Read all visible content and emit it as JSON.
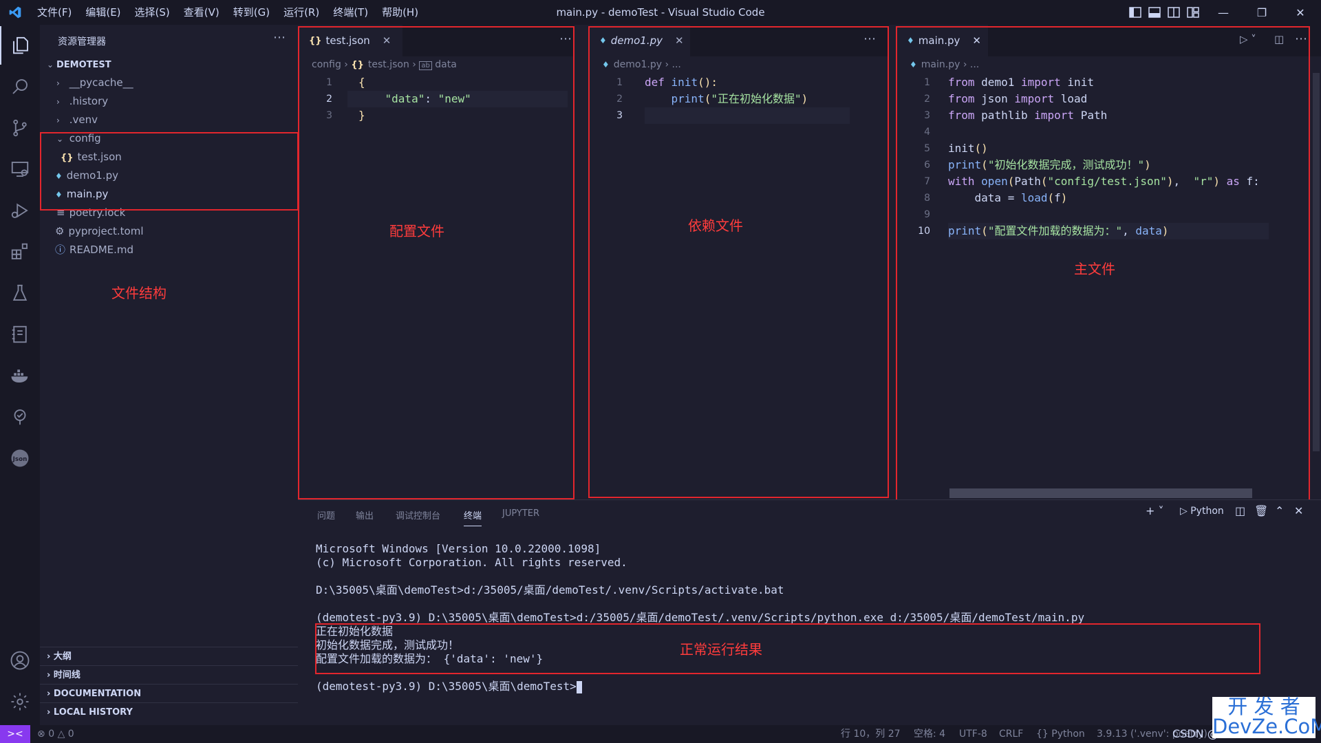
{
  "window": {
    "title": "main.py - demoTest - Visual Studio Code",
    "menu": [
      "文件(F)",
      "编辑(E)",
      "选择(S)",
      "查看(V)",
      "转到(G)",
      "运行(R)",
      "终端(T)",
      "帮助(H)"
    ]
  },
  "sidebar": {
    "title": "资源管理器",
    "root": "DEMOTEST",
    "items": [
      {
        "label": "__pycache__",
        "type": "folder"
      },
      {
        "label": ".history",
        "type": "folder"
      },
      {
        "label": ".venv",
        "type": "folder"
      },
      {
        "label": "config",
        "type": "folder-open"
      },
      {
        "label": "test.json",
        "type": "json"
      },
      {
        "label": "demo1.py",
        "type": "py"
      },
      {
        "label": "main.py",
        "type": "py"
      },
      {
        "label": "poetry.lock",
        "type": "lock"
      },
      {
        "label": "pyproject.toml",
        "type": "toml"
      },
      {
        "label": "README.md",
        "type": "md"
      }
    ],
    "sections": [
      "大纲",
      "时间线",
      "DOCUMENTATION",
      "LOCAL HISTORY"
    ]
  },
  "editors": {
    "json": {
      "tab": "test.json",
      "breadcrumb": [
        "config",
        "test.json",
        "data"
      ],
      "lines": [
        {
          "n": "1",
          "t": "{"
        },
        {
          "n": "2",
          "k": "\"data\"",
          "v": "\"new\""
        },
        {
          "n": "3",
          "t": "}"
        }
      ]
    },
    "demo": {
      "tab": "demo1.py",
      "breadcrumb": [
        "demo1.py",
        "..."
      ],
      "line_numbers": [
        "1",
        "2",
        "3"
      ],
      "def_kw": "def",
      "fn_name": "init",
      "paren": "():",
      "print_fn": "print",
      "print_str": "\"正在初始化数据\""
    },
    "main": {
      "tab": "main.py",
      "breadcrumb": [
        "main.py",
        "..."
      ],
      "line_numbers": [
        "1",
        "2",
        "3",
        "4",
        "5",
        "6",
        "7",
        "8",
        "9",
        "10"
      ],
      "l1": {
        "kw1": "from",
        "mod": "demo1",
        "kw2": "import",
        "name": "init"
      },
      "l2": {
        "kw1": "from",
        "mod": "json",
        "kw2": "import",
        "name": "load"
      },
      "l3": {
        "kw1": "from",
        "mod": "pathlib",
        "kw2": "import",
        "name": "Path"
      },
      "l5": {
        "fn": "init",
        "rest": "()"
      },
      "l6": {
        "fn": "print",
        "str": "\"初始化数据完成，测试成功！\""
      },
      "l7": {
        "kw": "with",
        "fn": "open",
        "path": "Path",
        "str1": "\"config/test.json\"",
        "str2": "\"r\"",
        "as": "as",
        "var": "f:"
      },
      "l8": {
        "var": "data",
        "fn": "load",
        "arg": "f"
      },
      "l10": {
        "fn": "print",
        "str": "\"配置文件加载的数据为：\"",
        "var": "data"
      }
    }
  },
  "annotations": {
    "file_structure": "文件结构",
    "config_file": "配置文件",
    "dependency_file": "依赖文件",
    "main_file": "主文件",
    "run_result": "正常运行结果"
  },
  "panel": {
    "tabs": [
      "问题",
      "输出",
      "调试控制台",
      "终端",
      "JUPYTER"
    ],
    "active_tab": "终端",
    "shell_label": "Python",
    "terminal_lines": [
      "Microsoft Windows [Version 10.0.22000.1098]",
      "(c) Microsoft Corporation. All rights reserved.",
      "",
      "D:\\35005\\桌面\\demoTest>d:/35005/桌面/demoTest/.venv/Scripts/activate.bat",
      "",
      "(demotest-py3.9) D:\\35005\\桌面\\demoTest>d:/35005/桌面/demoTest/.venv/Scripts/python.exe d:/35005/桌面/demoTest/main.py",
      "正在初始化数据",
      "初始化数据完成，测试成功！",
      "配置文件加载的数据为： {'data': 'new'}",
      "",
      "(demotest-py3.9) D:\\35005\\桌面\\demoTest>"
    ]
  },
  "statusbar": {
    "errors": "0",
    "warnings": "0",
    "position": "行 10，列 27",
    "spaces": "空格: 4",
    "encoding": "UTF-8",
    "eol": "CRLF",
    "language": "Python",
    "interpreter": "3.9.13 ('.venv': poetry)",
    "csdn": "CSDN @"
  },
  "watermark": {
    "line1": "开 发 者",
    "line2": "DevZe.CoM"
  },
  "colors": {
    "annotation_red": "#e3262d",
    "remote": "#8839ef",
    "background": "#1e1e2e"
  }
}
